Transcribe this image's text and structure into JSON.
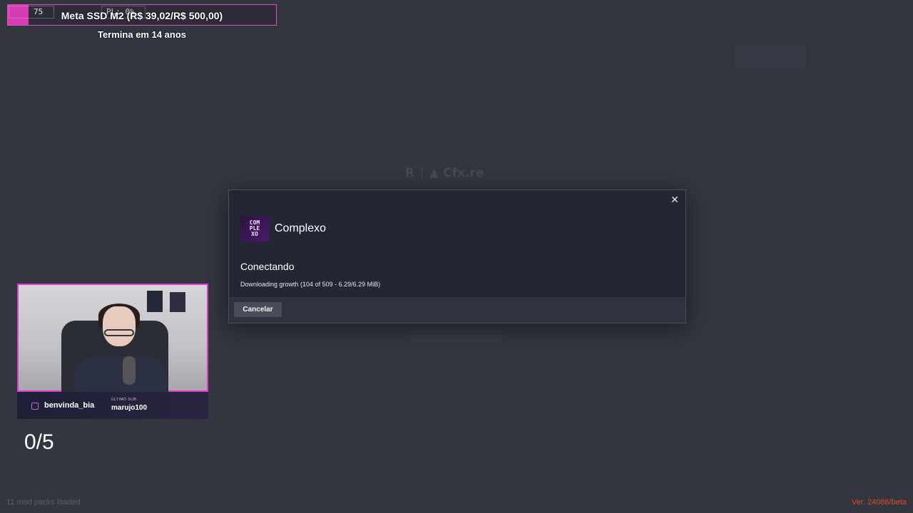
{
  "goal": {
    "text": "Meta SSD M2 (R$ 39,02/R$ 500,00)",
    "subtext": "Termina em 14 anos",
    "progress_fraction": 0.078,
    "color": "#d63db3"
  },
  "stats_overlay": {
    "fps_value": "75",
    "pl_text": "PL: 0%"
  },
  "modal": {
    "close_icon": "close-icon",
    "server_logo_text": "COM\nPLE\nXO",
    "server_name": "Complexo",
    "status_title": "Conectando",
    "status_detail": "Downloading growth (104 of 509 - 6.29/6.29 MiB)",
    "cancel_label": "Cancelar"
  },
  "webcam": {
    "instagram_handle": "benvinda_bia",
    "sub_label": "ÚLTIMO SUB:",
    "last_sub": "marujo100"
  },
  "counter": "0/5",
  "footer": {
    "mods_loaded": "11 mod packs loaded",
    "version": "Ver. 24086/beta"
  }
}
